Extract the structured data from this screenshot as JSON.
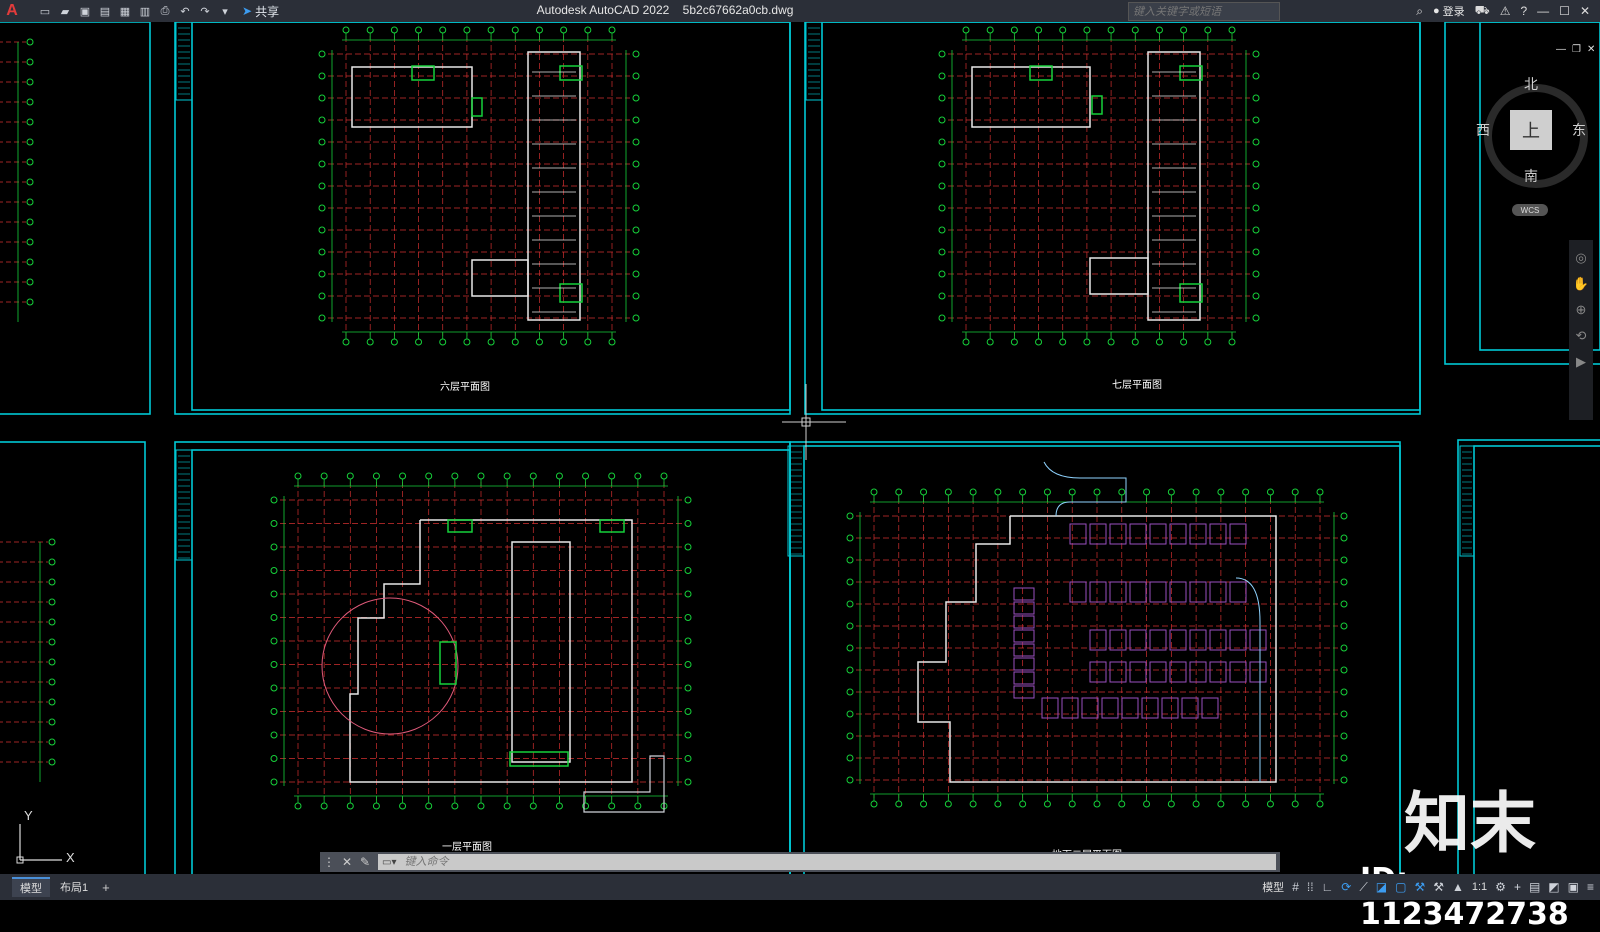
{
  "app": {
    "logo": "A",
    "title": "Autodesk AutoCAD 2022",
    "filename": "5b2c67662a0cb.dwg",
    "share_label": "共享",
    "search_placeholder": "键入关键字或短语",
    "login_label": "登录"
  },
  "quick_access": [
    "new-icon",
    "open-icon",
    "save-icon",
    "saveas-icon",
    "plot-preview-icon",
    "publish-icon",
    "print-icon",
    "undo-icon",
    "redo-icon",
    "customize-icon"
  ],
  "viewcube": {
    "north": "北",
    "south": "南",
    "west": "西",
    "east": "东",
    "face": "上",
    "wcs": "WCS"
  },
  "plans": {
    "p6": "六层平面图",
    "p7": "七层平面图",
    "p1": "一层平面图",
    "b2": "地下二层平面图"
  },
  "ucs": {
    "y": "Y",
    "x": "X"
  },
  "command": {
    "placeholder": "键入命令"
  },
  "layout_tabs": [
    "模型",
    "布局1"
  ],
  "status": {
    "model_label": "模型",
    "scale": "1:1"
  },
  "watermark": {
    "logo": "知末",
    "id": "ID: 1123472738"
  },
  "colors": {
    "cyan_frame": "#00c8d4",
    "grid_red": "#d23030",
    "grid_green": "#16d13a",
    "wall": "#e8e8e8",
    "purple_parking": "#9a4fbf"
  }
}
